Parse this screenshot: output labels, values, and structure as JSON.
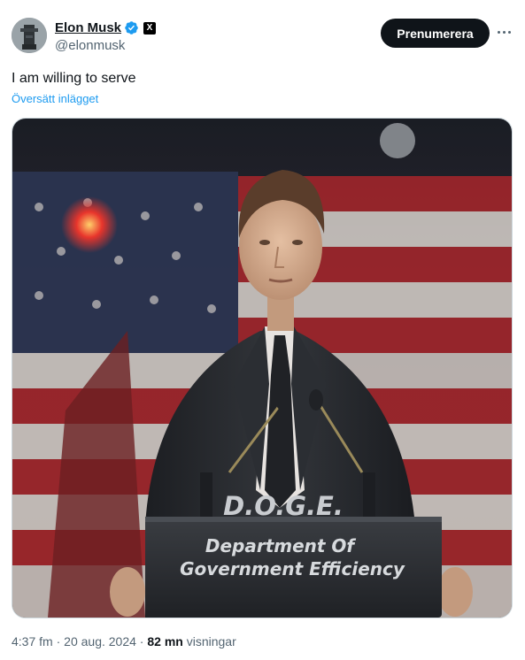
{
  "author": {
    "display_name": "Elon Musk",
    "handle": "@elonmusk",
    "verified_icon": "verified-badge-icon",
    "affiliate_badge": "X"
  },
  "actions": {
    "subscribe_label": "Prenumerera",
    "more_icon": "more-horizontal-icon"
  },
  "tweet": {
    "text": "I am willing to serve",
    "translate_label": "Översätt inlägget"
  },
  "media": {
    "podium_acronym": "D.O.G.E.",
    "podium_line1": "Department Of",
    "podium_line2": "Government Efficiency"
  },
  "meta": {
    "time": "4:37 fm",
    "separator1": "·",
    "date": "20 aug. 2024",
    "separator2": "·",
    "views_count": "82 mn",
    "views_label": "visningar"
  },
  "colors": {
    "link": "#1d9bf0",
    "verified": "#1d9bf0",
    "button_bg": "#0f1419",
    "secondary_text": "#536471"
  }
}
